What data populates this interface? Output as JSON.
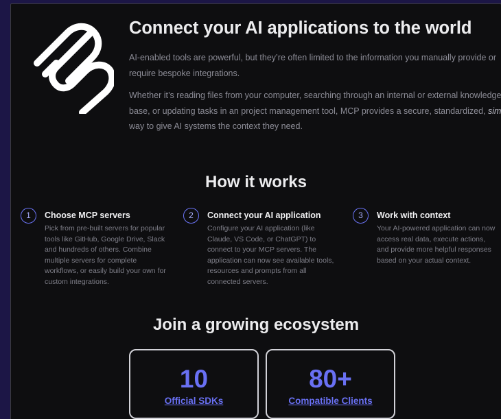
{
  "hero": {
    "title": "Connect your AI applications to the world",
    "paragraph1": "AI-enabled tools are powerful, but they’re often limited to the information you manually provide or require bespoke integrations.",
    "paragraph2_before": "Whether it’s reading files from your computer, searching through an internal or external knowledge base, or updating tasks in an project management tool, MCP provides a secure, standardized, ",
    "paragraph2_emph": "simple",
    "paragraph2_after": " way to give AI systems the context they need."
  },
  "how": {
    "title": "How it works",
    "steps": [
      {
        "number": "1",
        "title": "Choose MCP servers",
        "description": "Pick from pre-built servers for popular tools like GitHub, Google Drive, Slack and hundreds of others. Combine multiple servers for complete workflows, or easily build your own for custom integrations."
      },
      {
        "number": "2",
        "title": "Connect your AI application",
        "description": "Configure your AI application (like Claude, VS Code, or ChatGPT) to connect to your MCP servers. The application can now see available tools, resources and prompts from all connected servers."
      },
      {
        "number": "3",
        "title": "Work with context",
        "description": "Your AI-powered application can now access real data, execute actions, and provide more helpful responses based on your actual context."
      }
    ]
  },
  "ecosystem": {
    "title": "Join a growing ecosystem",
    "stats": [
      {
        "value": "10",
        "label": "Official SDKs"
      },
      {
        "value": "80+",
        "label": "Compatible Clients"
      }
    ]
  },
  "colors": {
    "page_background": "#1c1646",
    "panel_background": "#0e0e10",
    "accent": "#6970f3",
    "heading": "#ececee",
    "body_text": "#8c8c96"
  },
  "icons": {
    "logo": "mcp-logo-icon"
  }
}
